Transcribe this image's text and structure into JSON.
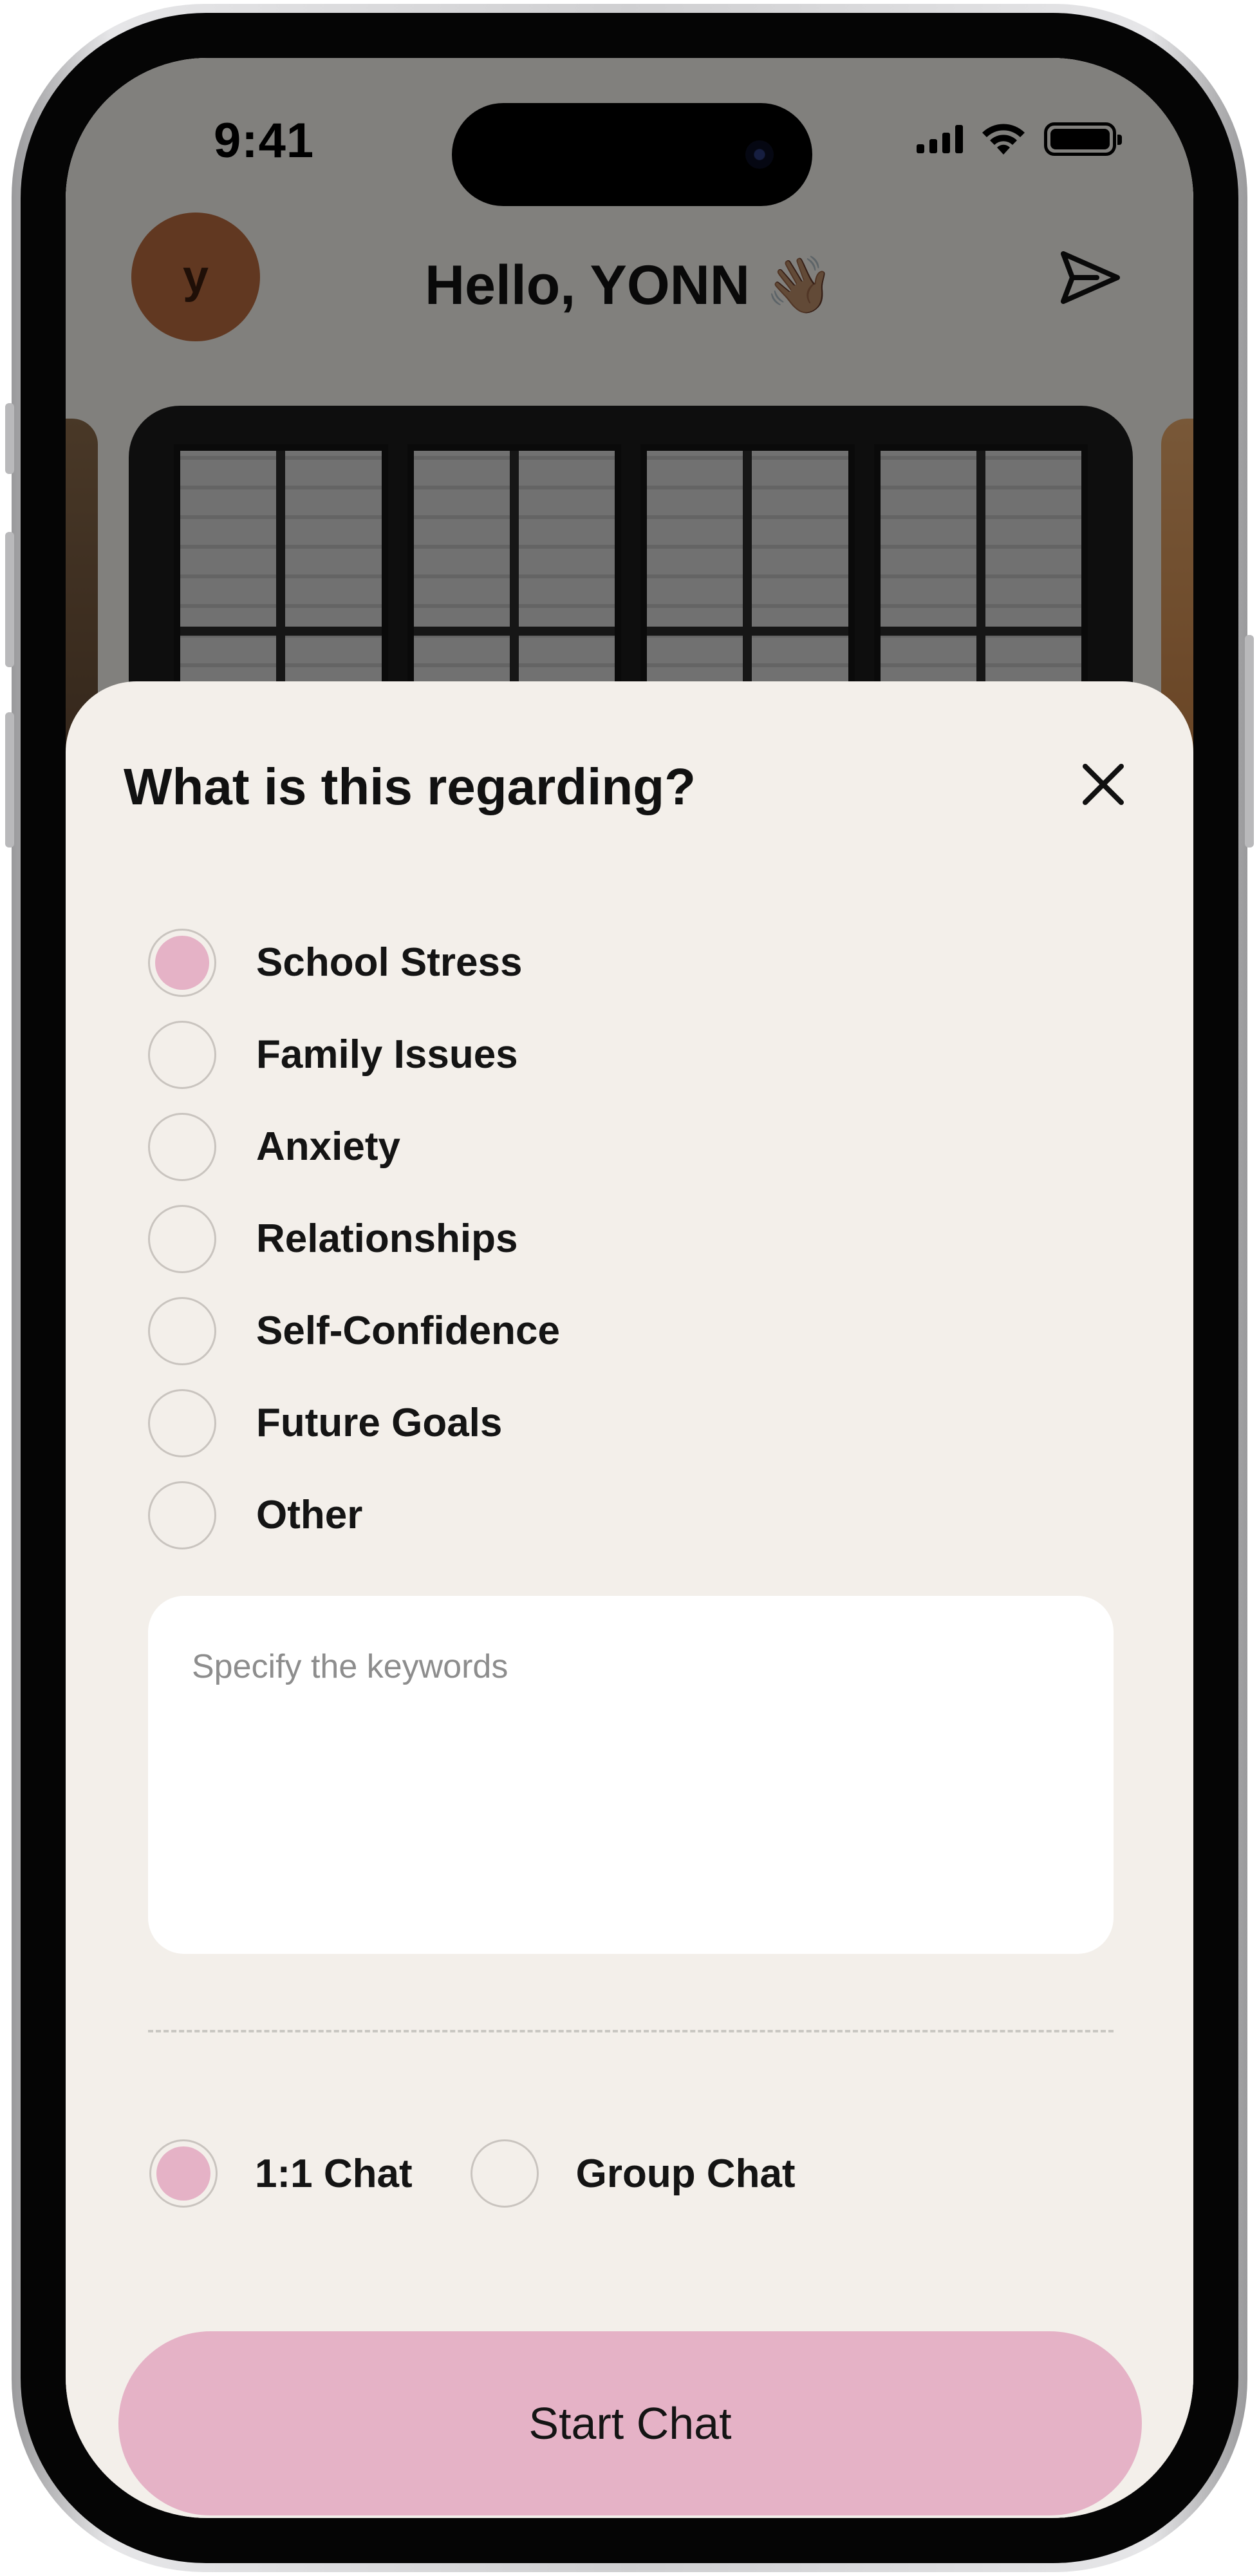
{
  "status_bar": {
    "time": "9:41"
  },
  "header": {
    "avatar_initial": "y",
    "greeting": "Hello, YONN 👋🏽"
  },
  "sheet": {
    "title": "What is this regarding?",
    "topics": [
      {
        "label": "School Stress",
        "selected": true
      },
      {
        "label": "Family Issues",
        "selected": false
      },
      {
        "label": "Anxiety",
        "selected": false
      },
      {
        "label": "Relationships",
        "selected": false
      },
      {
        "label": "Self-Confidence",
        "selected": false
      },
      {
        "label": "Future Goals",
        "selected": false
      },
      {
        "label": "Other",
        "selected": false
      }
    ],
    "keywords": {
      "placeholder": "Specify the keywords",
      "value": ""
    },
    "chat_types": [
      {
        "label": "1:1 Chat",
        "selected": true
      },
      {
        "label": "Group Chat",
        "selected": false
      }
    ],
    "start_button": "Start Chat"
  },
  "colors": {
    "accent_pink": "#e5b2c6",
    "sheet_background": "#f3efea",
    "avatar": "#b86a3f"
  },
  "icons": {
    "close": "close-icon",
    "send": "send-icon"
  }
}
